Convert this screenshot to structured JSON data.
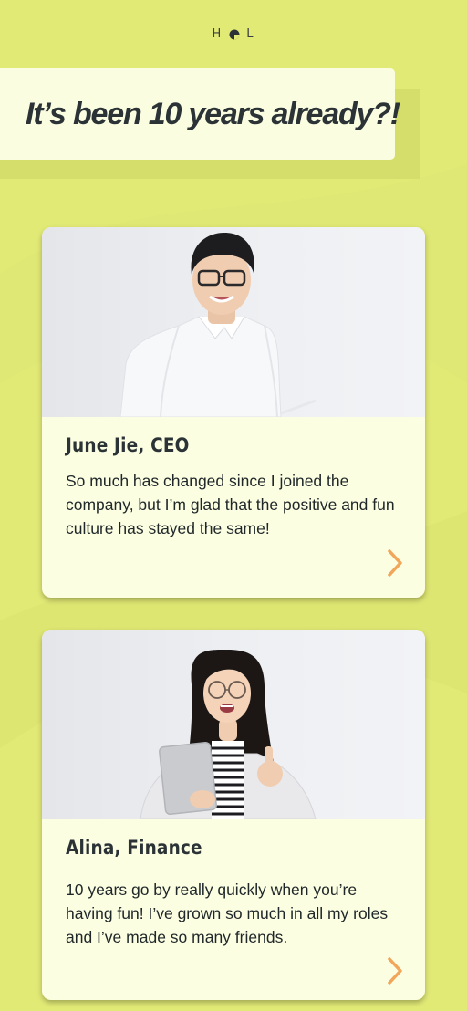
{
  "logo": {
    "left_letter": "H",
    "right_letter": "L"
  },
  "page_title": "It’s been 10 years already?!",
  "colors": {
    "background": "#e2ea76",
    "card": "#fcfee2",
    "title_box": "#fbfde1",
    "text_dark": "#2b3336",
    "accent_orange": "#f2a65a"
  },
  "cards": [
    {
      "name": "June Jie, CEO",
      "quote": "So much has changed since I joined the company, but I’m glad that the positive and fun culture has stayed the same!",
      "icon": "chevron-right-icon"
    },
    {
      "name": "Alina, Finance",
      "quote": "10 years go by really quickly when you’re having fun! I’ve grown so much in all my roles and I’ve made so many friends.",
      "icon": "chevron-right-icon"
    }
  ]
}
